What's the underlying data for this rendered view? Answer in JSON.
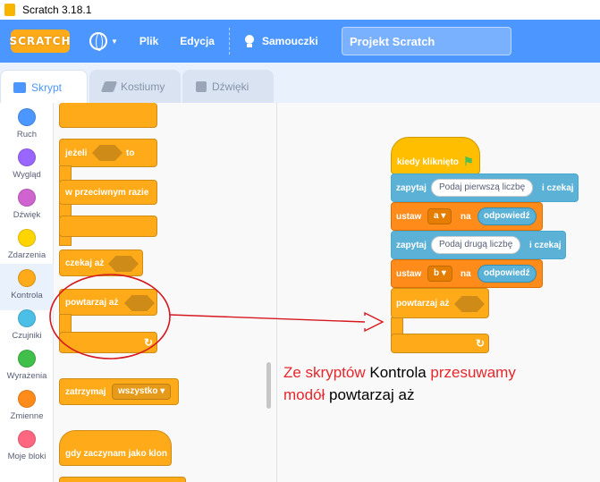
{
  "window": {
    "title": "Scratch 3.18.1"
  },
  "menubar": {
    "logo": "SCRATCH",
    "file": "Plik",
    "edit": "Edycja",
    "tutorials": "Samouczki",
    "project_title": "Projekt Scratch"
  },
  "tabs": [
    {
      "label": "Skrypt",
      "active": true
    },
    {
      "label": "Kostiumy",
      "active": false
    },
    {
      "label": "Dźwięki",
      "active": false
    }
  ],
  "categories": [
    {
      "label": "Ruch",
      "color": "#4c97ff"
    },
    {
      "label": "Wygląd",
      "color": "#9966ff"
    },
    {
      "label": "Dźwięk",
      "color": "#cf63cf"
    },
    {
      "label": "Zdarzenia",
      "color": "#ffd500"
    },
    {
      "label": "Kontrola",
      "color": "#ffab19",
      "selected": true
    },
    {
      "label": "Czujniki",
      "color": "#4cbfe6"
    },
    {
      "label": "Wyrażenia",
      "color": "#40bf4a"
    },
    {
      "label": "Zmienne",
      "color": "#ff8c1a"
    },
    {
      "label": "Moje bloki",
      "color": "#ff6680"
    }
  ],
  "palette": {
    "if_label": "jeżeli",
    "then_label": "to",
    "else_label": "w przeciwnym razie",
    "wait_until": "czekaj aż",
    "repeat_until": "powtarzaj aż",
    "stop_label": "zatrzymaj",
    "stop_option": "wszystko",
    "clone_start": "gdy zaczynam jako klon"
  },
  "script": {
    "when_clicked": "kiedy kliknięto",
    "ask1": {
      "label": "zapytaj",
      "value": "Podaj pierwszą liczbę",
      "suffix": "i czekaj"
    },
    "set1": {
      "label": "ustaw",
      "var": "a",
      "on": "na",
      "value": "odpowiedź"
    },
    "ask2": {
      "label": "zapytaj",
      "value": "Podaj drugą liczbę",
      "suffix": "i czekaj"
    },
    "set2": {
      "label": "ustaw",
      "var": "b",
      "on": "na",
      "value": "odpowiedź"
    },
    "repeat_until": "powtarzaj aż"
  },
  "note": {
    "p1": "Ze skryptów",
    "p2": " Kontrola ",
    "p3": "przesuwamy",
    "p4": "modół",
    "p5": " powtarzaj aż"
  },
  "colors": {
    "accent": "#4c97ff",
    "control": "#ffab19",
    "sensing": "#5cb1d6",
    "variables": "#ff8c1a",
    "annotation_red": "#e8262b"
  }
}
